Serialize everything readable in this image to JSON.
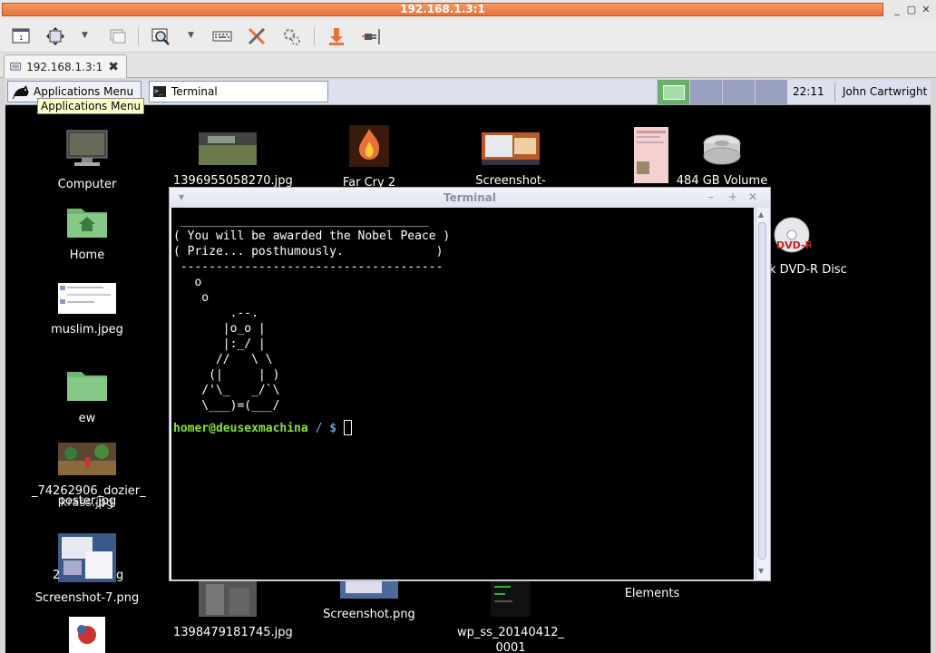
{
  "window": {
    "title": "192.168.1.3:1"
  },
  "toolbar": {
    "icons": [
      "view-icon",
      "fullscreen-icon",
      "windows-icon",
      "zoom-icon",
      "keyboard-icon",
      "tools-icon",
      "settings-icon",
      "transfer-icon",
      "disconnect-icon"
    ]
  },
  "tab": {
    "label": "192.168.1.3:1"
  },
  "panel": {
    "apps_menu_label": "Applications Menu",
    "tooltip": "Applications Menu",
    "task_label": "Terminal",
    "clock": "22:11",
    "user": "John Cartwright",
    "workspaces": 4,
    "active_workspace": 1
  },
  "desktop": {
    "icons": {
      "computer": "Computer",
      "img1": "1396955058270.jpg",
      "farcry": "Far Cry 2",
      "qemu": "Screenshot-QEMU.",
      "volume": "484 GB Volume",
      "home": "Home",
      "dvd": "k DVD-R Disc",
      "muslim": "muslim.jpeg",
      "ew": "ew",
      "dozier": "_74262906_dozier_",
      "poster": "poster.jpg",
      "krass": "krass.jpg",
      "shot7": "Screenshot-7.png",
      "shot7prefix": "2",
      "shot7suffix": "g",
      "img2": "1398479181745.jpg",
      "shotpng": "Screenshot.png",
      "wpss": "wp_ss_20140412_",
      "wpss2": "0001",
      "elements": "Elements"
    }
  },
  "terminal": {
    "title": "Terminal",
    "output": " ___________________________________\n( You will be awarded the Nobel Peace )\n( Prize... posthumously.             )\n -------------------------------------\n   o\n    o\n        .--.\n       |o_o |\n       |:_/ |\n      //   \\ \\\n     (|     | )\n    /'\\_   _/`\\\n    \\___)=(___/",
    "prompt_user": "homer@deusexmachina",
    "prompt_path": " / $ "
  }
}
